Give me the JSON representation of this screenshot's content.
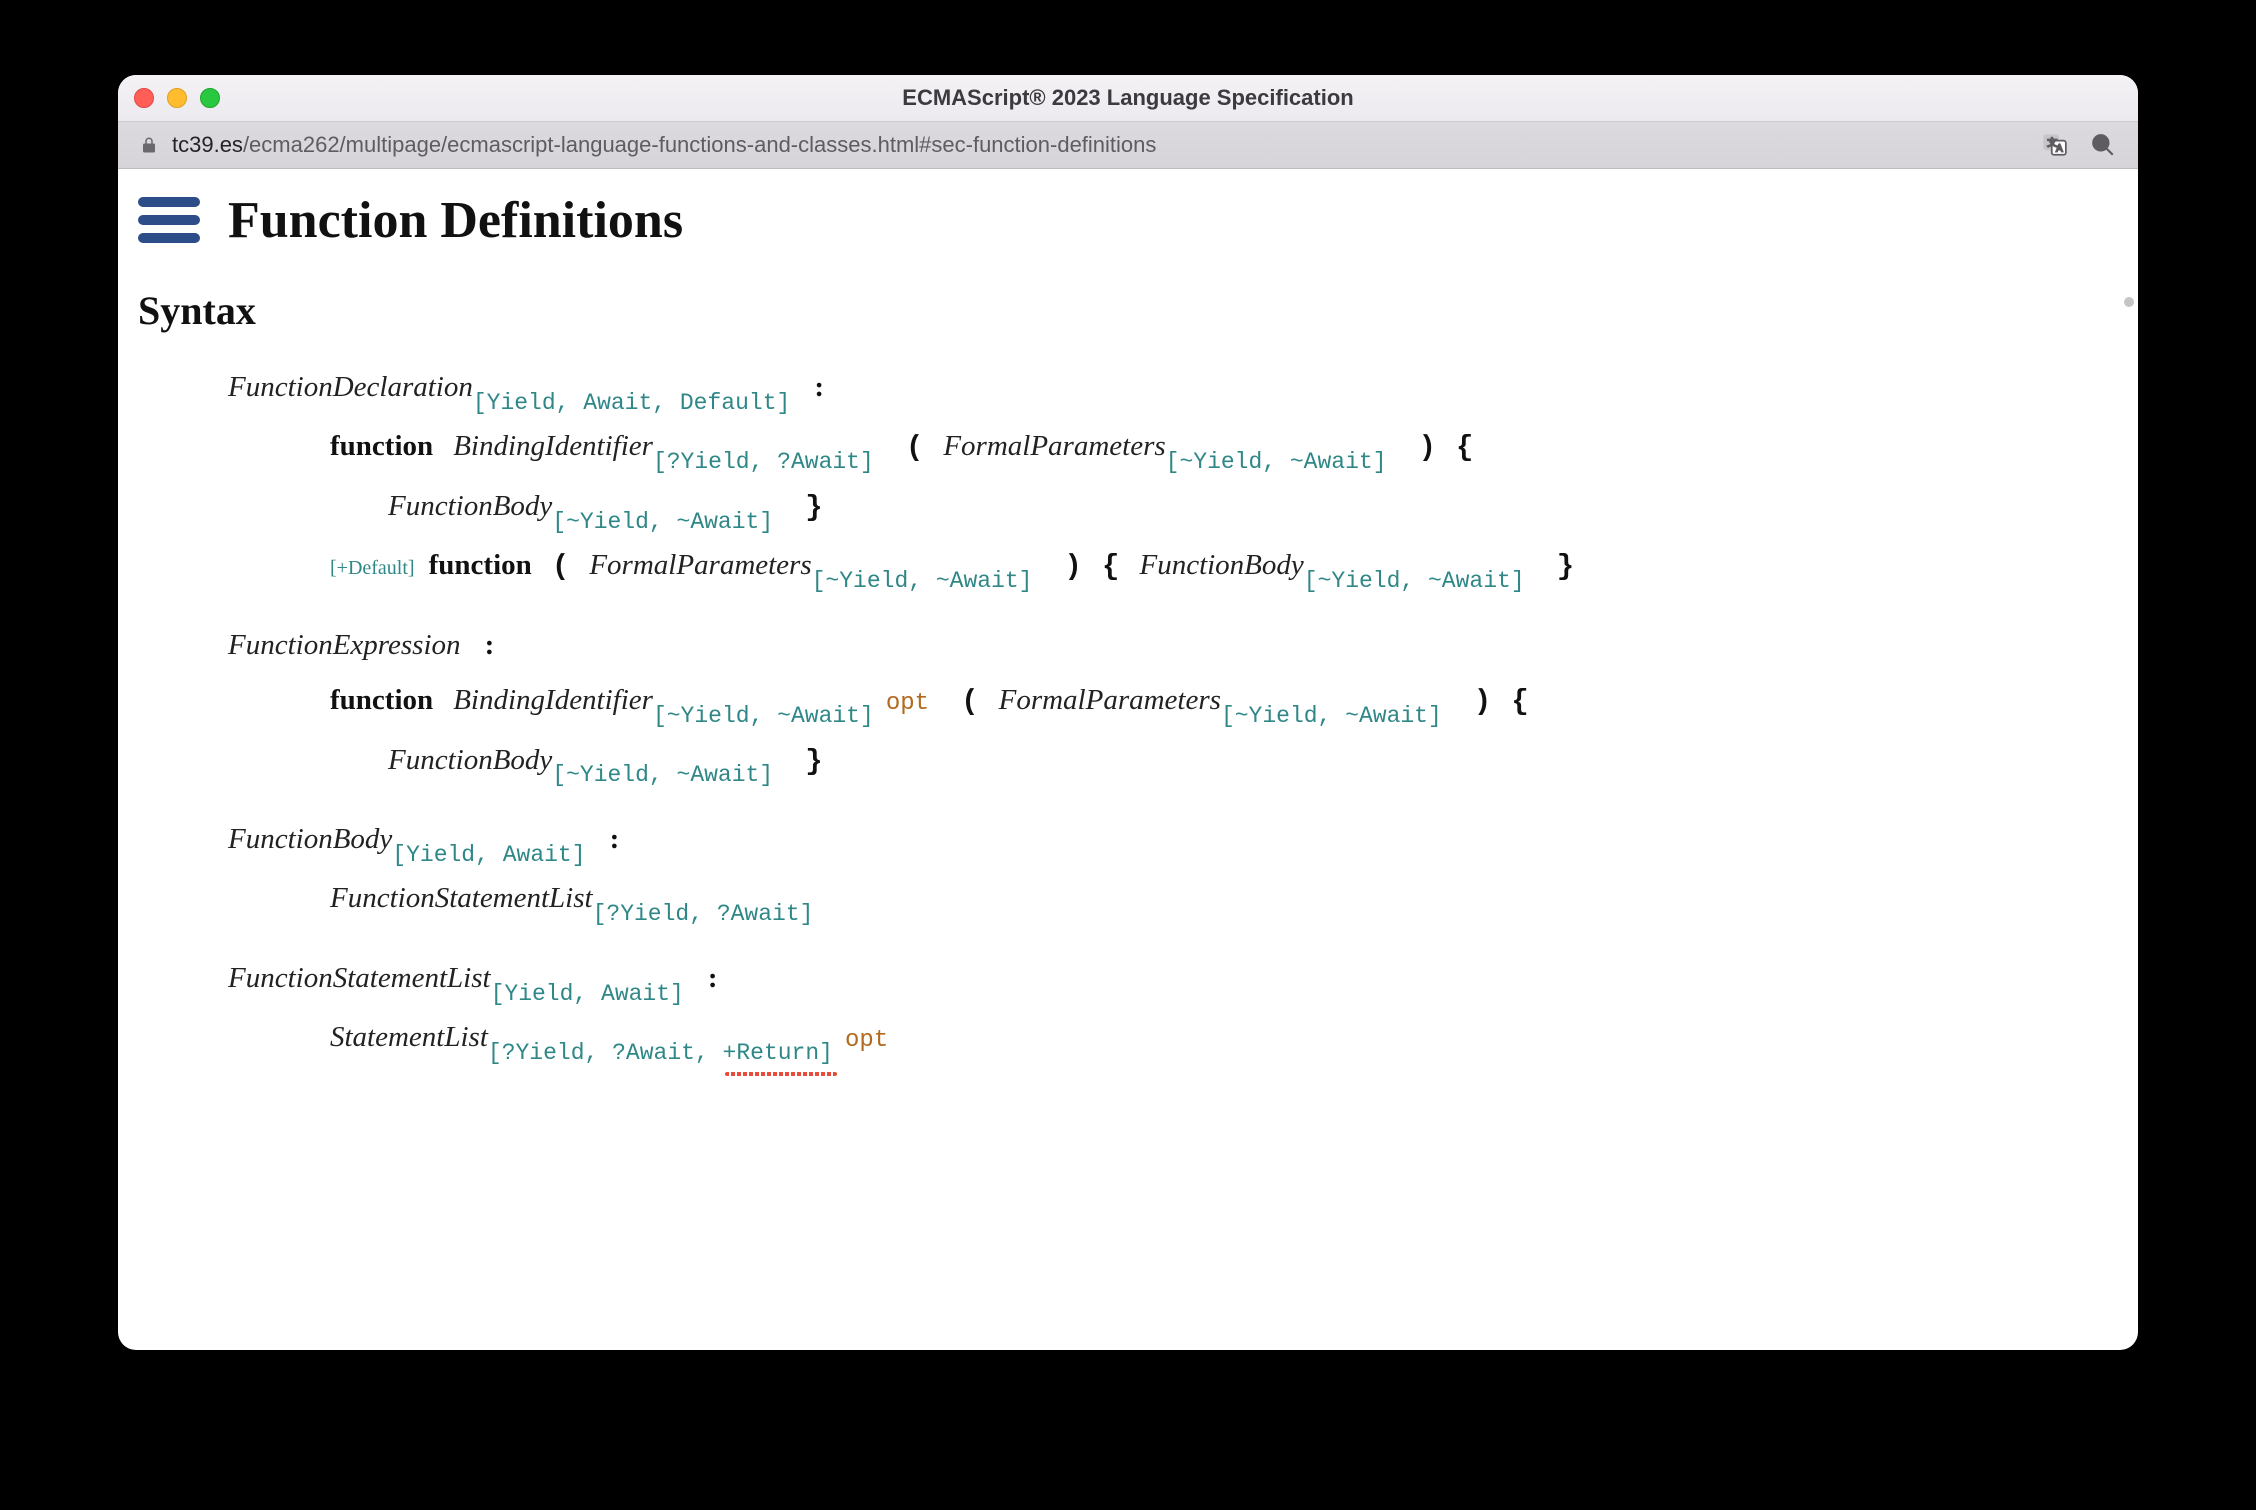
{
  "window": {
    "title": "ECMAScript® 2023 Language Specification",
    "url_host": "tc39.es",
    "url_path": "/ecma262/multipage/ecmascript-language-functions-and-classes.html#sec-function-definitions"
  },
  "page": {
    "heading": "Function Definitions",
    "section": "Syntax"
  },
  "grammar": {
    "p1": {
      "lhs": "FunctionDeclaration",
      "lhs_params": "[Yield, Await, Default]",
      "colon": ":",
      "r1_kw": "function",
      "r1_nt1": "BindingIdentifier",
      "r1_nt1_p": "[?Yield, ?Await]",
      "r1_open": "(",
      "r1_nt2": "FormalParameters",
      "r1_nt2_p": "[~Yield, ~Await]",
      "r1_close": ")",
      "r1_lb": "{",
      "r1b_nt": "FunctionBody",
      "r1b_nt_p": "[~Yield, ~Await]",
      "r1b_rb": "}",
      "r2_guard": "[+Default]",
      "r2_kw": "function",
      "r2_open": "(",
      "r2_nt1": "FormalParameters",
      "r2_nt1_p": "[~Yield, ~Await]",
      "r2_close": ")",
      "r2_lb": "{",
      "r2_nt2": "FunctionBody",
      "r2_nt2_p": "[~Yield, ~Await]",
      "r2_rb": "}"
    },
    "p2": {
      "lhs": "FunctionExpression",
      "colon": ":",
      "r1_kw": "function",
      "r1_nt1": "BindingIdentifier",
      "r1_nt1_p": "[~Yield, ~Await]",
      "r1_opt": "opt",
      "r1_open": "(",
      "r1_nt2": "FormalParameters",
      "r1_nt2_p": "[~Yield, ~Await]",
      "r1_close": ")",
      "r1_lb": "{",
      "r1b_nt": "FunctionBody",
      "r1b_nt_p": "[~Yield, ~Await]",
      "r1b_rb": "}"
    },
    "p3": {
      "lhs": "FunctionBody",
      "lhs_params": "[Yield, Await]",
      "colon": ":",
      "r1_nt": "FunctionStatementList",
      "r1_nt_p": "[?Yield, ?Await]"
    },
    "p4": {
      "lhs": "FunctionStatementList",
      "lhs_params": "[Yield, Await]",
      "colon": ":",
      "r1_nt": "StatementList",
      "r1_nt_p_a": "[?Yield, ?Await, ",
      "r1_nt_p_b": "+Return]",
      "r1_opt": "opt"
    }
  }
}
